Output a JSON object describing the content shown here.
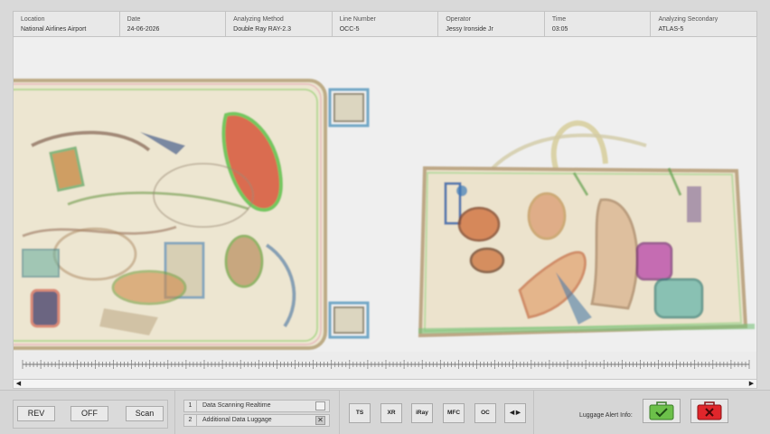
{
  "header": {
    "cells": [
      {
        "label": "Location",
        "value": "National Airlines Airport"
      },
      {
        "label": "Date",
        "value": "24-06-2026"
      },
      {
        "label": "Analyzing Method",
        "value": "Double Ray RAY-2.3"
      },
      {
        "label": "Line Number",
        "value": "OCC-5"
      },
      {
        "label": "Operator",
        "value": "Jessy Ironside Jr"
      },
      {
        "label": "Time",
        "value": "03:05"
      },
      {
        "label": "Analyzing Secondary",
        "value": "ATLAS-5"
      }
    ]
  },
  "scan": {
    "items": [
      {
        "name": "suitcase",
        "icon": "xray-suitcase"
      },
      {
        "name": "handbag",
        "icon": "xray-handbag"
      }
    ]
  },
  "scrollbar": {
    "left_icon": "◀",
    "right_icon": "▶"
  },
  "controls": {
    "rev_label": "REV",
    "off_label": "OFF",
    "scan_label": "Scan"
  },
  "options": [
    {
      "num": "1",
      "label": "Data Scanning Realtime",
      "checked": false,
      "mark": ""
    },
    {
      "num": "2",
      "label": "Additional Data Luggage",
      "checked": true,
      "mark": "✕"
    }
  ],
  "tools": [
    {
      "id": "ts",
      "label": "TS"
    },
    {
      "id": "xr",
      "label": "XR"
    },
    {
      "id": "iray",
      "label": "iRay"
    },
    {
      "id": "mfc",
      "label": "MFC"
    },
    {
      "id": "oc",
      "label": "OC"
    },
    {
      "id": "nav",
      "label": "◀ ▶"
    }
  ],
  "alert": {
    "label": "Luggage Alert Info:",
    "ok_icon": "green-luggage-check-icon",
    "alarm_icon": "red-luggage-x-icon",
    "colors": {
      "ok": "#6cc04a",
      "alarm": "#e0262b"
    }
  }
}
